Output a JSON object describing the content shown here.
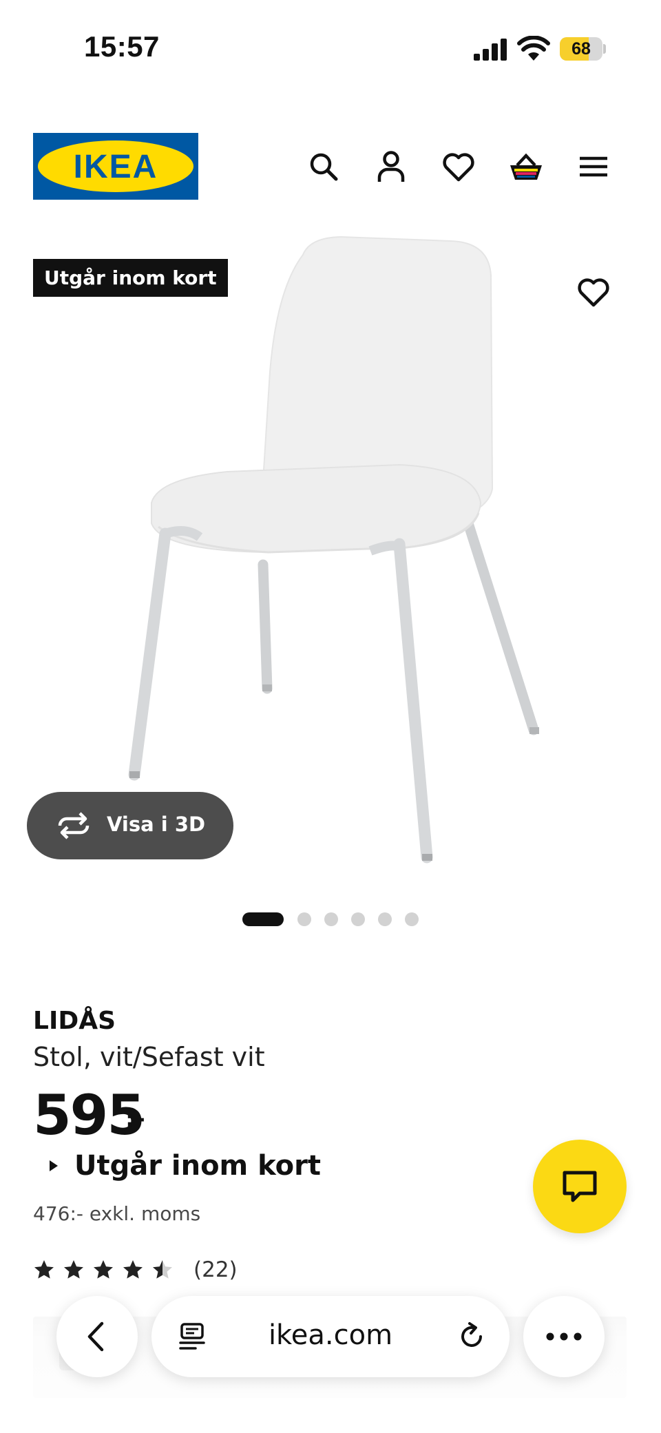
{
  "status_bar": {
    "time": "15:57",
    "battery": "68",
    "battery_color": "#f7cf2c"
  },
  "header": {
    "logo_text": "IKEA",
    "brand_blue": "#0058a3",
    "brand_yellow": "#ffdb00",
    "icons": [
      "search-icon",
      "account-icon",
      "wishlist-icon",
      "basket-icon",
      "menu-icon"
    ]
  },
  "gallery": {
    "badge": "Utgår inom kort",
    "view_3d_label": "Visa i 3D",
    "slide_count": 6,
    "active_slide": 1
  },
  "product": {
    "name": "LIDÅS",
    "description": "Stol, vit/Sefast vit",
    "price": "595",
    "price_suffix": ":-",
    "availability": "Utgår inom kort",
    "price_ex_vat": "476:- exkl. moms",
    "rating": 4.5,
    "rating_max": 5,
    "review_count": "(22)"
  },
  "chat": {
    "icon": "chat-icon",
    "color": "#fbd914"
  },
  "browser": {
    "url": "ikea.com"
  }
}
